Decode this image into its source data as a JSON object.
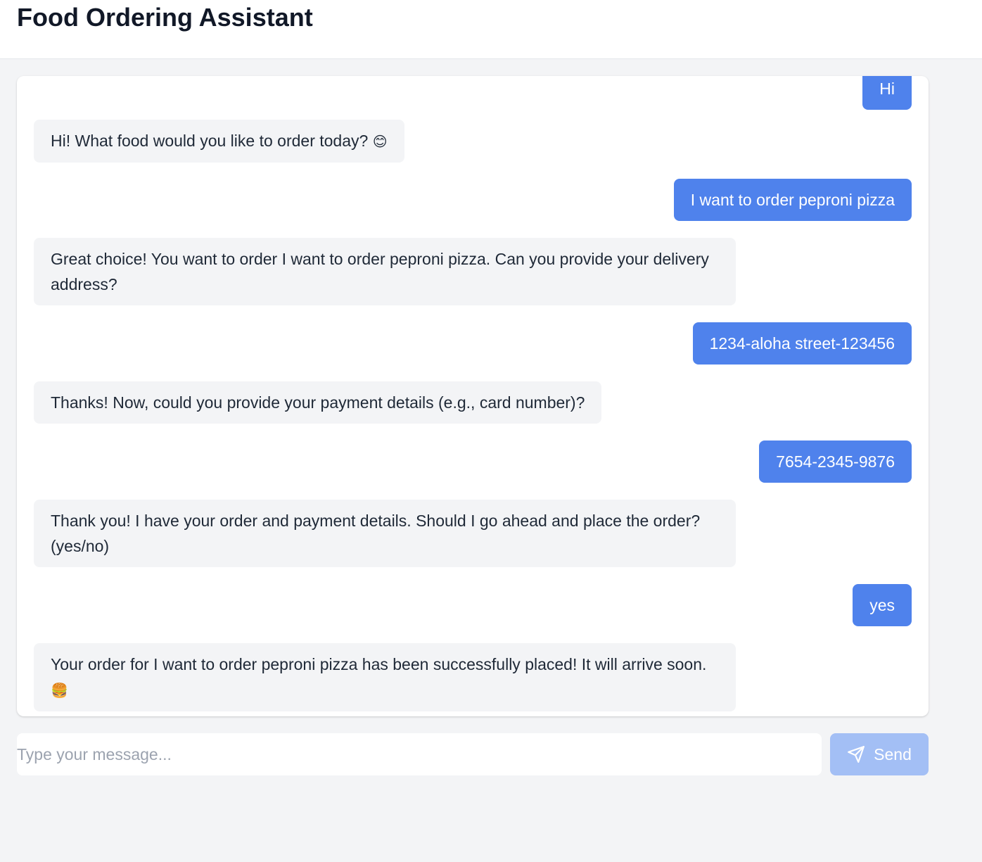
{
  "header": {
    "title": "Food Ordering Assistant"
  },
  "messages": [
    {
      "role": "user",
      "text": "Hi"
    },
    {
      "role": "bot",
      "text": "Hi! What food would you like to order today?",
      "emoji": "😊"
    },
    {
      "role": "user",
      "text": "I want to order peproni pizza"
    },
    {
      "role": "bot",
      "text": "Great choice! You want to order I want to order peproni pizza. Can you provide your delivery address?"
    },
    {
      "role": "user",
      "text": "1234-aloha street-123456"
    },
    {
      "role": "bot",
      "text": "Thanks! Now, could you provide your payment details (e.g., card number)?"
    },
    {
      "role": "user",
      "text": "7654-2345-9876"
    },
    {
      "role": "bot",
      "text": "Thank you! I have your order and payment details. Should I go ahead and place the order? (yes/no)"
    },
    {
      "role": "user",
      "text": "yes"
    },
    {
      "role": "bot",
      "text": "Your order for I want to order peproni pizza has been successfully placed! It will arrive soon.",
      "emoji": "🍔"
    }
  ],
  "composer": {
    "placeholder": "Type your message...",
    "value": "",
    "send_label": "Send",
    "send_icon": "paper-plane-icon"
  },
  "colors": {
    "user_bubble": "#4f82ec",
    "bot_bubble": "#f3f4f6",
    "send_button_disabled": "#a3bff5",
    "page_background": "#f3f4f6"
  }
}
